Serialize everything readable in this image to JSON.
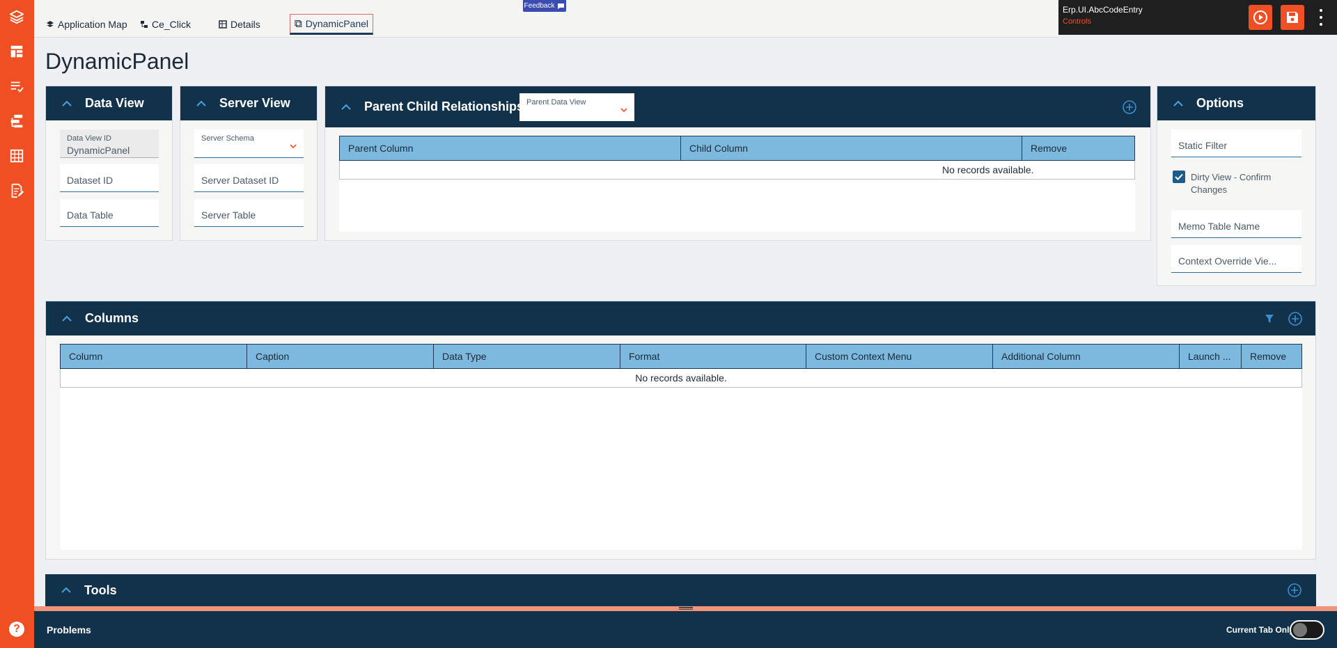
{
  "tabs": [
    {
      "label": "Application Map",
      "icon": "layers-icon"
    },
    {
      "label": "Ce_Click",
      "icon": "workflow-icon"
    },
    {
      "label": "Details",
      "icon": "grid-icon"
    },
    {
      "label": "DynamicPanel",
      "icon": "panel-icon",
      "active": true
    }
  ],
  "feedback": {
    "label": "Feedback"
  },
  "header": {
    "app": "Erp.UI.AbcCodeEntry",
    "context": "Controls"
  },
  "page_title": "DynamicPanel",
  "data_view": {
    "title": "Data View",
    "data_view_id_label": "Data View ID",
    "data_view_id_value": "DynamicPanel",
    "dataset_id_ph": "Dataset ID",
    "data_table_ph": "Data Table"
  },
  "server_view": {
    "title": "Server View",
    "server_schema_label": "Server Schema",
    "server_dataset_id_ph": "Server Dataset ID",
    "server_table_ph": "Server Table"
  },
  "parent_child": {
    "title": "Parent Child Relationships",
    "parent_data_view_label": "Parent Data View",
    "columns": [
      "Parent Column",
      "Child Column",
      "Remove"
    ],
    "empty": "No records available."
  },
  "options": {
    "title": "Options",
    "static_filter_ph": "Static Filter",
    "dirty_view_label_1": "Dirty View - Confirm",
    "dirty_view_label_2": "Changes",
    "dirty_view_checked": true,
    "memo_table_ph": "Memo Table Name",
    "context_override_ph": "Context Override Vie..."
  },
  "columns_panel": {
    "title": "Columns",
    "columns": [
      "Column",
      "Caption",
      "Data Type",
      "Format",
      "Custom Context Menu",
      "Additional Column",
      "Launch ...",
      "Remove"
    ],
    "empty": "No records available."
  },
  "tools_panel": {
    "title": "Tools"
  },
  "bottom": {
    "problems": "Problems",
    "current_tab_only": "Current Tab Only",
    "toggle_on": false
  },
  "help": {
    "glyph": "?"
  },
  "colors": {
    "brand": "#f04e23",
    "navy": "#11324a",
    "grid_header": "#7db8df"
  }
}
